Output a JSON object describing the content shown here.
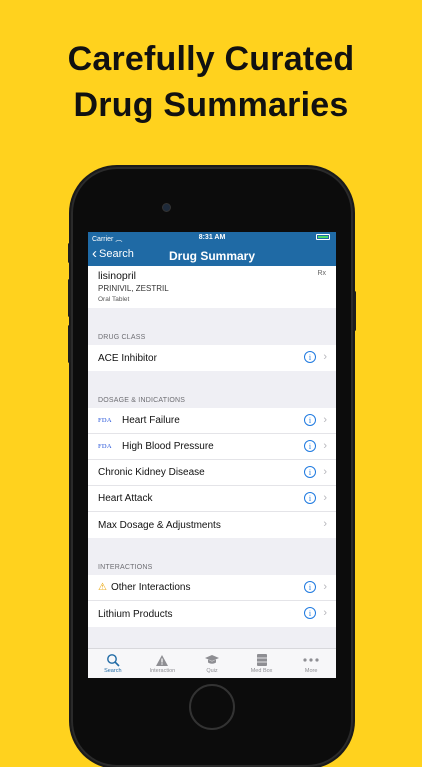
{
  "headline": {
    "line1": "Carefully Curated",
    "line2": "Drug Summaries"
  },
  "status": {
    "carrier": "Carrier",
    "time": "8:31 AM"
  },
  "nav": {
    "back": "Search",
    "title": "Drug Summary"
  },
  "drug": {
    "name": "lisinopril",
    "brands": "PRINIVIL, ZESTRIL",
    "form": "Oral Tablet",
    "rx": "Rx"
  },
  "sections": {
    "drug_class": {
      "header": "DRUG CLASS",
      "rows": [
        {
          "label": "ACE Inhibitor"
        }
      ]
    },
    "dosage": {
      "header": "DOSAGE & INDICATIONS",
      "rows": [
        {
          "label": "Heart Failure",
          "tag": "FDA"
        },
        {
          "label": "High Blood Pressure",
          "tag": "FDA"
        },
        {
          "label": "Chronic Kidney Disease"
        },
        {
          "label": "Heart Attack"
        },
        {
          "label": "Max Dosage & Adjustments"
        }
      ]
    },
    "interactions": {
      "header": "INTERACTIONS",
      "rows": [
        {
          "label": "Other Interactions"
        },
        {
          "label": "Lithium Products"
        }
      ]
    }
  },
  "tabs": [
    {
      "label": "Search",
      "icon": "search-icon"
    },
    {
      "label": "Interaction",
      "icon": "warning-icon"
    },
    {
      "label": "Quiz",
      "icon": "graduation-cap-icon"
    },
    {
      "label": "Med Box",
      "icon": "med-box-icon"
    },
    {
      "label": "More",
      "icon": "more-icon"
    }
  ],
  "colors": {
    "accent": "#1f6aa5",
    "background": "#FFD21E",
    "info": "#1f7ae0"
  }
}
